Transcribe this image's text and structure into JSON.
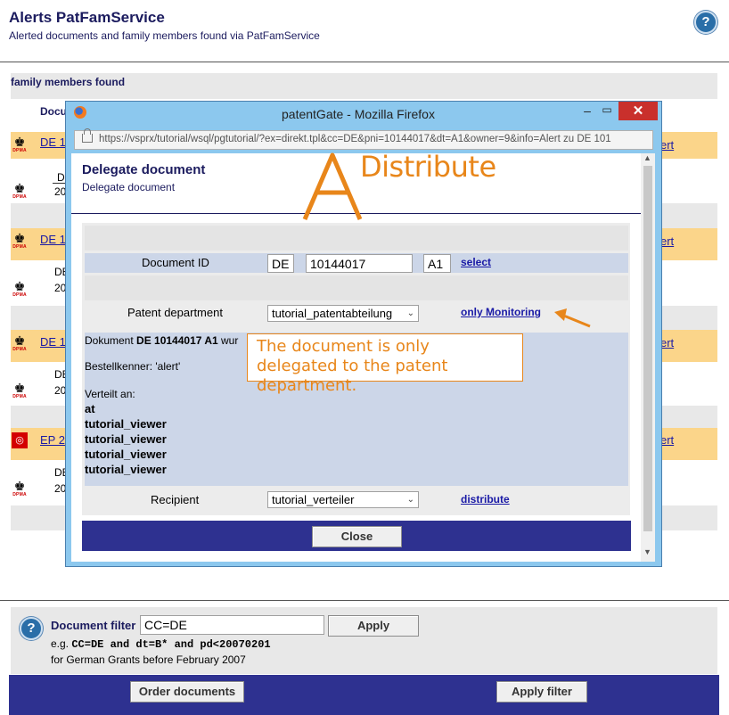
{
  "header": {
    "title": "Alerts PatFamService",
    "subtitle": "Alerted documents and family members found via PatFamService",
    "help_glyph": "?"
  },
  "background": {
    "section_title": "family members found",
    "column_head": "Docu",
    "rows": [
      {
        "code": "DE 1",
        "detail": "D",
        "year": "20",
        "link": "ert"
      },
      {
        "code": "DE 1",
        "detail": "DE",
        "year": "20",
        "link": "ert"
      },
      {
        "code": "DE 1",
        "detail": "DE",
        "year": "20",
        "link": "ert"
      },
      {
        "code": "EP 2",
        "detail": "DE",
        "year": "20",
        "link": "ert"
      }
    ],
    "dpma_label": "DPMA"
  },
  "popup": {
    "window_title": "patentGate - Mozilla Firefox",
    "url": "https://vsprx/tutorial/wsql/pgtutorial/?ex=direkt.tpl&cc=DE&pni=10144017&dt=A1&owner=9&info=Alert zu DE 101",
    "heading": "Delegate document",
    "subheading": "Delegate document",
    "document_id_label": "Document ID",
    "cc_value": "DE",
    "number_value": "10144017",
    "kind_value": "A1",
    "select_link": "select",
    "patent_dept_label": "Patent department",
    "patent_dept_value": "tutorial_patentabteilung",
    "only_monitoring_link": "only Monitoring",
    "doc_text_prefix": "Dokument ",
    "doc_id_bold": "DE 10144017 A1",
    "doc_text_suffix": " wur",
    "order_code": "Bestellkenner: 'alert'",
    "distributed_to": "Verteilt an:",
    "recipients": [
      "at",
      "tutorial_viewer",
      "tutorial_viewer",
      "tutorial_viewer",
      "tutorial_viewer"
    ],
    "recipient_label": "Recipient",
    "recipient_value": "tutorial_verteiler",
    "distribute_link": "distribute",
    "close_button": "Close"
  },
  "annotation": {
    "letter": "A",
    "word": "Distribute",
    "callout": "The document is only delegated to the patent department.",
    "color": "#e8861a"
  },
  "filter": {
    "label": "Document filter",
    "value": "CC=DE",
    "apply": "Apply",
    "example_prefix": "e.g. ",
    "example_code": "CC=DE and dt=B* and pd<20070201",
    "example_note": "for German Grants before February 2007"
  },
  "footer": {
    "order_button": "Order documents",
    "apply_filter_button": "Apply filter"
  }
}
